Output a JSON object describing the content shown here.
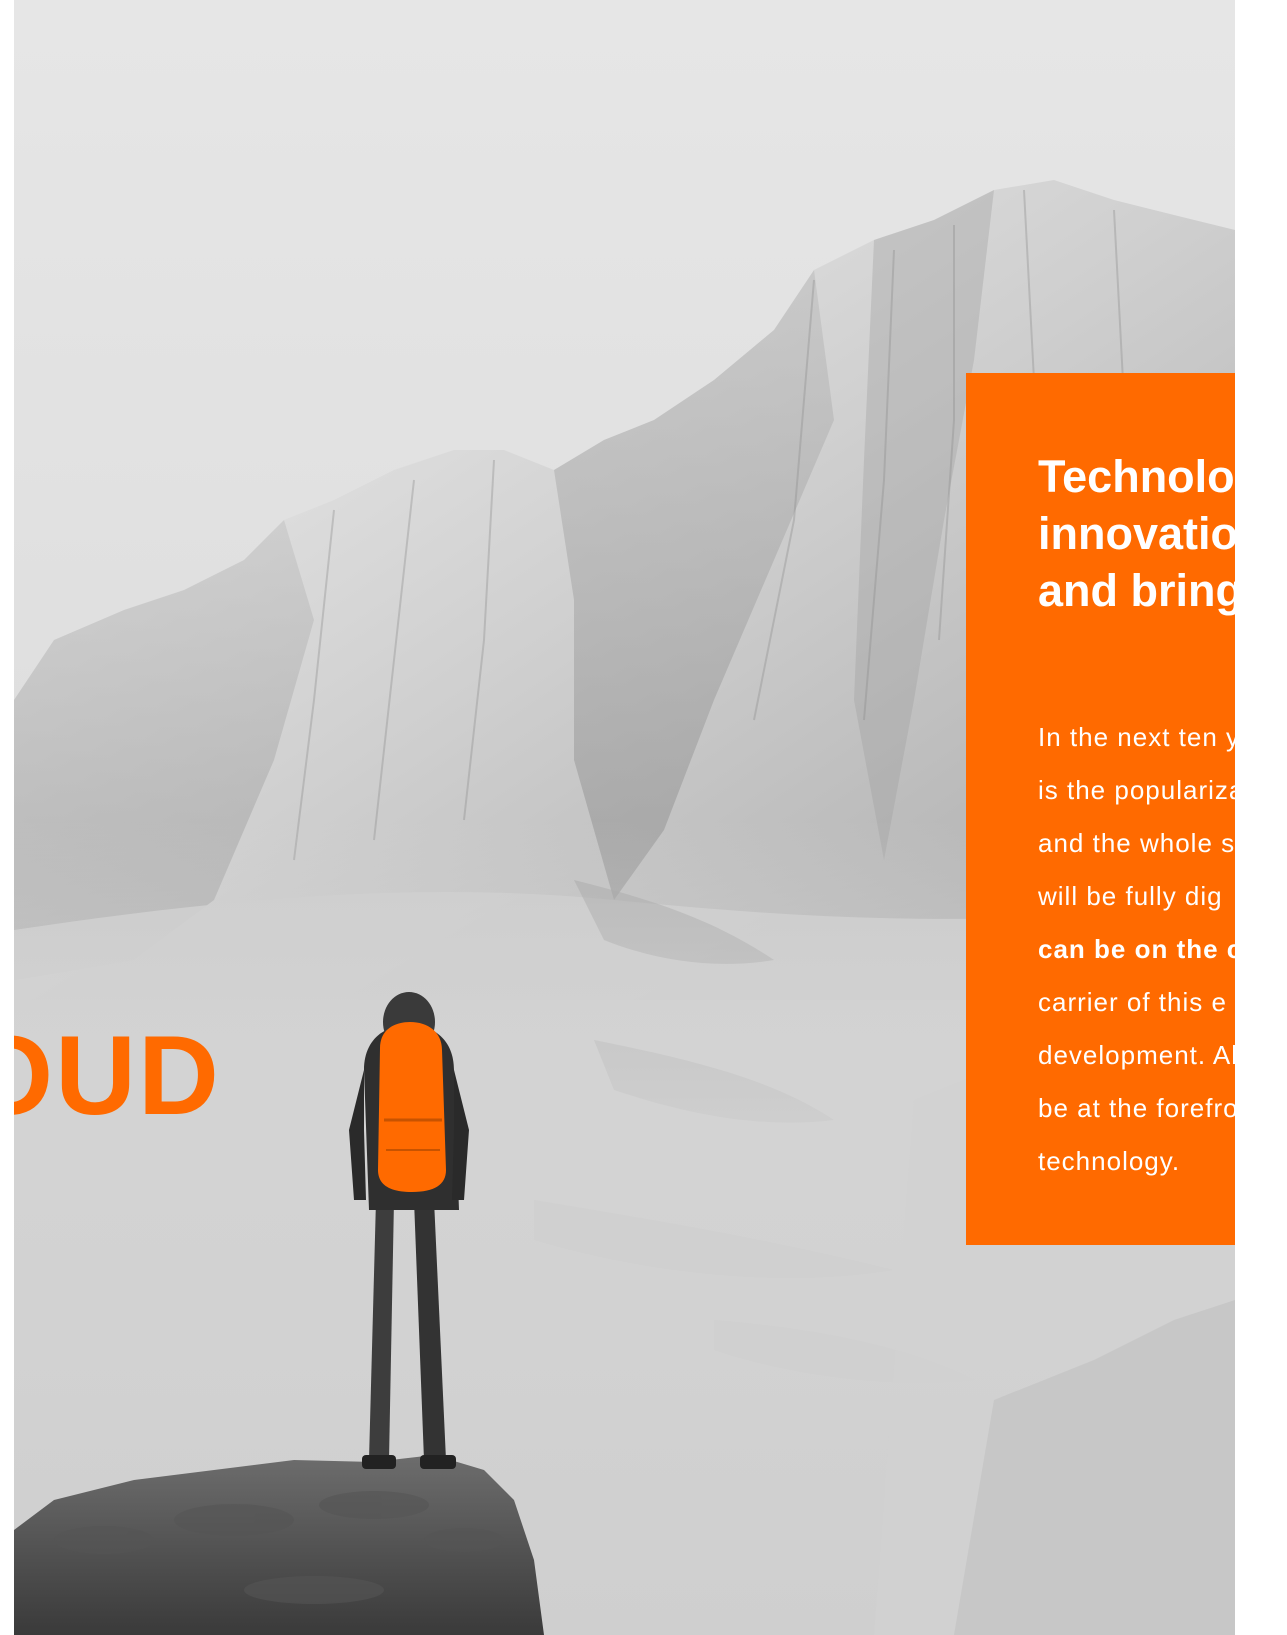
{
  "hero": {
    "word": "OUD"
  },
  "panel": {
    "title_lines": [
      "Technolog",
      "innovation",
      "and brings"
    ],
    "body_lines": [
      "In the next ten y",
      "is the populariza",
      "and the whole so",
      "will be fully dig",
      "can be on the c",
      "carrier of this e",
      "development. Al",
      "be at the forefron",
      "technology."
    ],
    "bold_line_index": 4
  },
  "colors": {
    "accent": "#ff6a00",
    "text_on_accent": "#ffffff",
    "photo_base": "#d8d8d8"
  },
  "icons": {
    "figure": "hiker-figure"
  }
}
